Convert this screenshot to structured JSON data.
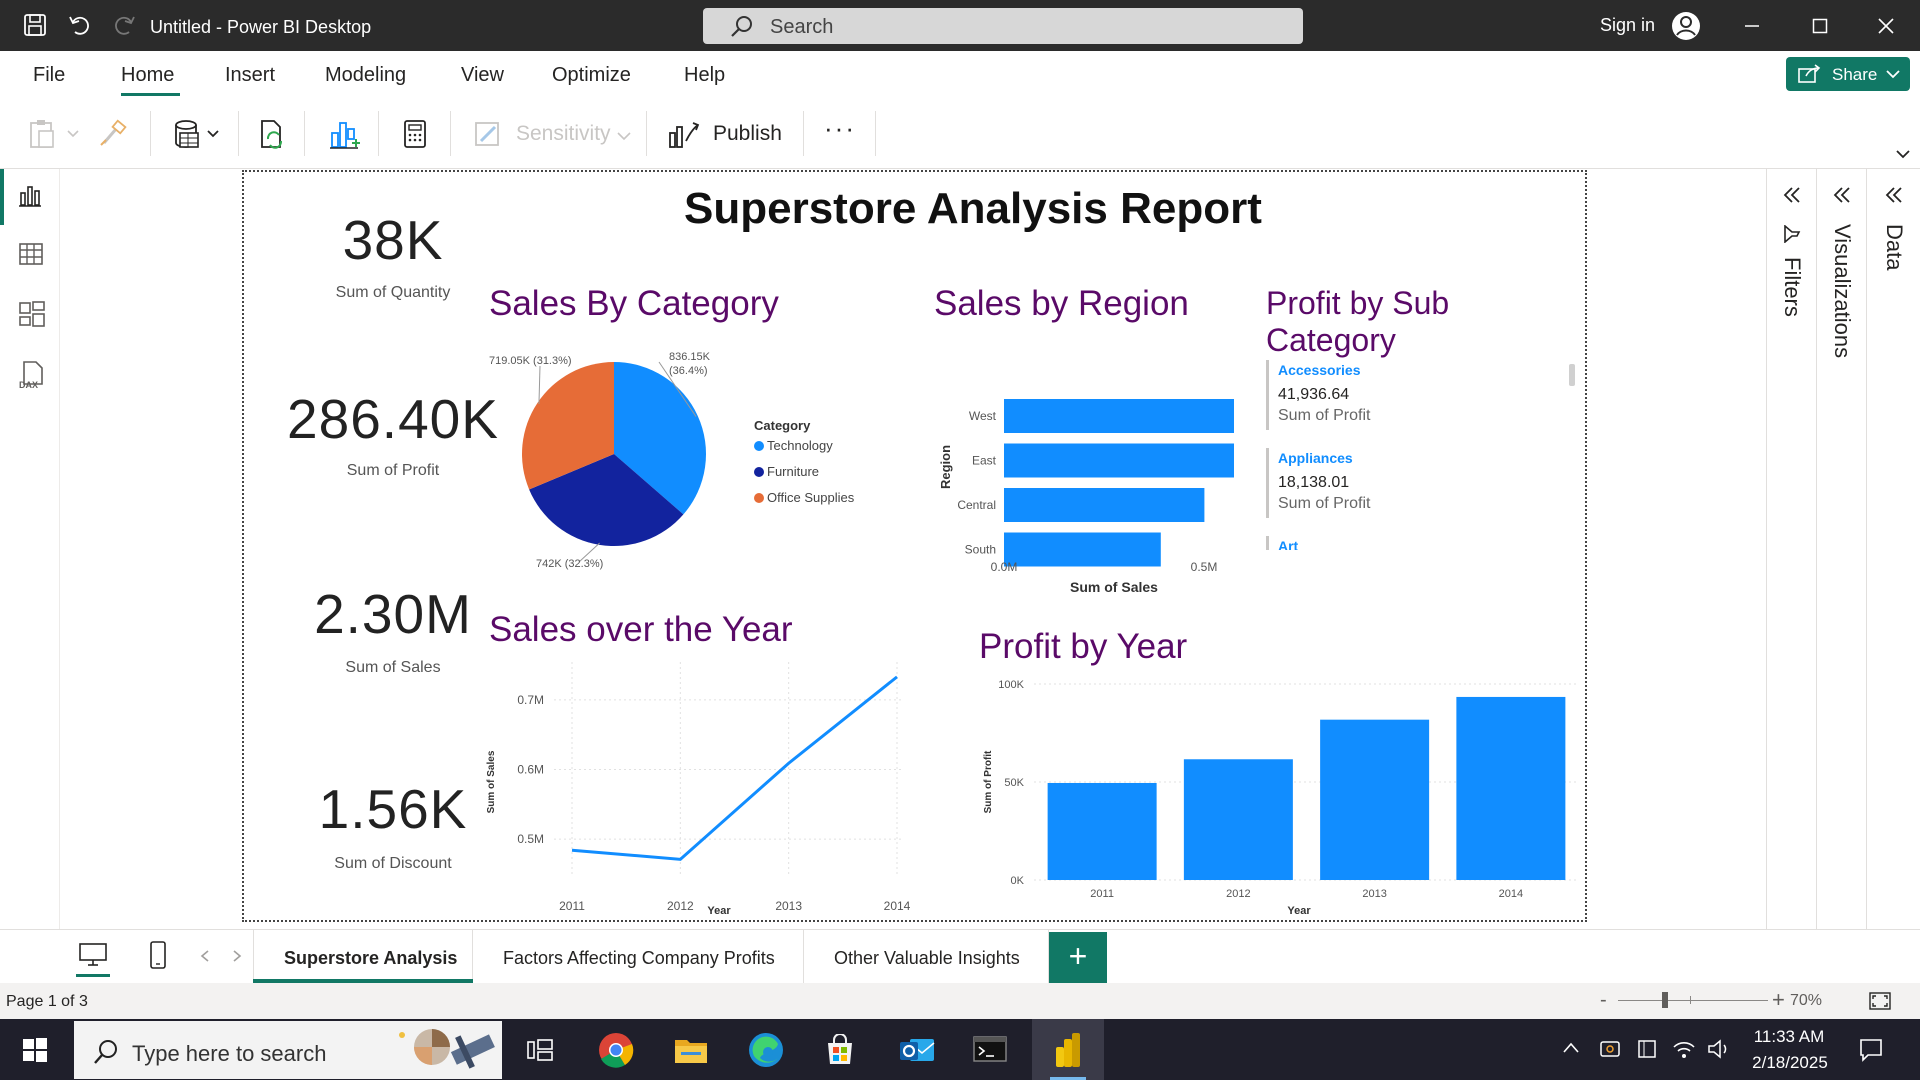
{
  "window": {
    "title": "Untitled - Power BI Desktop",
    "search_placeholder": "Search",
    "sign_in": "Sign in"
  },
  "menu": {
    "items": [
      "File",
      "Home",
      "Insert",
      "Modeling",
      "View",
      "Optimize",
      "Help"
    ],
    "active": "Home",
    "share_label": "Share"
  },
  "ribbon": {
    "sensitivity_label": "Sensitivity",
    "publish_label": "Publish",
    "more_label": "···"
  },
  "panes": {
    "filters": "Filters",
    "visualizations": "Visualizations",
    "data": "Data"
  },
  "report": {
    "title": "Superstore Analysis Report",
    "kpis": [
      {
        "value": "38K",
        "label": "Sum of Quantity"
      },
      {
        "value": "286.40K",
        "label": "Sum of Profit"
      },
      {
        "value": "2.30M",
        "label": "Sum of Sales"
      },
      {
        "value": "1.56K",
        "label": "Sum of Discount"
      }
    ],
    "visual_titles": {
      "pie": "Sales By Category",
      "region": "Sales by Region",
      "subcat": "Profit by Sub Category",
      "line": "Sales over the Year",
      "profit_year": "Profit by Year"
    },
    "subcategory_cards": [
      {
        "category": "Accessories",
        "value": "41,936.64",
        "measure": "Sum of Profit"
      },
      {
        "category": "Appliances",
        "value": "18,138.01",
        "measure": "Sum of Profit"
      },
      {
        "category": "Art",
        "value": "",
        "measure": ""
      }
    ]
  },
  "chart_data": [
    {
      "type": "pie",
      "title": "Sales By Category",
      "legend_title": "Category",
      "legend_position": "right",
      "slices": [
        {
          "label": "Technology",
          "value": 836150,
          "display": "836.15K",
          "percent": "(36.4%)",
          "color": "#118dff"
        },
        {
          "label": "Furniture",
          "value": 742000,
          "display": "742K (32.3%)",
          "percent": "",
          "color": "#12239e"
        },
        {
          "label": "Office Supplies",
          "value": 719050,
          "display": "719.05K (31.3%)",
          "percent": "",
          "color": "#e66c37"
        }
      ]
    },
    {
      "type": "bar",
      "orientation": "horizontal",
      "title": "Sales by Region",
      "categories": [
        "West",
        "East",
        "Central",
        "South"
      ],
      "values": [
        725000,
        678000,
        501000,
        392000
      ],
      "xlabel": "Sum of Sales",
      "ylabel": "Region",
      "xticks": [
        "0.0M",
        "0.5M"
      ],
      "xlim": [
        0,
        1000000
      ],
      "color": "#118dff"
    },
    {
      "type": "line",
      "title": "Sales over the Year",
      "x": [
        "2011",
        "2012",
        "2013",
        "2014"
      ],
      "y": [
        484000,
        471000,
        609000,
        733000
      ],
      "xlabel": "Year",
      "ylabel": "Sum of Sales",
      "yticks": [
        "0.5M",
        "0.6M",
        "0.7M"
      ],
      "ylim": [
        0.46,
        0.74
      ],
      "grid": true,
      "color": "#118dff"
    },
    {
      "type": "bar",
      "title": "Profit by Year",
      "categories": [
        "2011",
        "2012",
        "2013",
        "2014"
      ],
      "values": [
        49500,
        61600,
        81800,
        93400
      ],
      "xlabel": "Year",
      "ylabel": "Sum of Profit",
      "yticks": [
        "0K",
        "50K",
        "100K"
      ],
      "ylim": [
        0,
        100000
      ],
      "grid": true,
      "color": "#118dff"
    }
  ],
  "page_tabs": [
    "Superstore Analysis",
    "Factors Affecting Company Profits",
    "Other Valuable Insights"
  ],
  "add_page_label": "+",
  "status": {
    "page_indicator": "Page 1 of 3",
    "zoom": "70%"
  },
  "taskbar": {
    "search_placeholder": "Type here to search",
    "time": "11:33 AM",
    "date": "2/18/2025"
  }
}
